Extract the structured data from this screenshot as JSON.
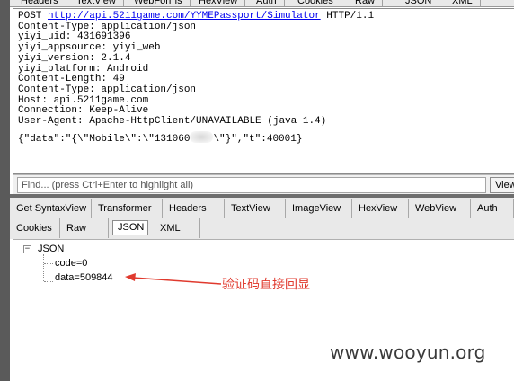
{
  "top_tabs": [
    "Headers",
    "TextView",
    "WebForms",
    "HexView",
    "Auth",
    "Cookies",
    "Raw",
    "JSON",
    "XML"
  ],
  "request": {
    "method": "POST",
    "url": "http://api.5211game.com/YYMEPassport/Simulator",
    "protocol": "HTTP/1.1",
    "lines": [
      "Content-Type: application/json",
      "yiyi_uid: 431691396",
      "yiyi_appsource: yiyi_web",
      "yiyi_version: 2.1.4",
      "yiyi_platform: Android",
      "Content-Length: 49",
      "Content-Type: application/json",
      "Host: api.5211game.com",
      "Connection: Keep-Alive",
      "User-Agent: Apache-HttpClient/UNAVAILABLE (java 1.4)"
    ],
    "body_prefix": "{\"data\":\"{\\\"Mobile\\\":\\\"131060",
    "body_suffix": "\\\"}\",\"t\":40001}"
  },
  "find_bar": {
    "placeholder": "Find... (press Ctrl+Enter to highlight all)",
    "view_button": "View"
  },
  "response_tabs": {
    "row1": [
      "Get SyntaxView",
      "Transformer",
      "Headers",
      "TextView",
      "ImageView",
      "HexView",
      "WebView",
      "Auth"
    ],
    "row2": [
      "Cookies",
      "Raw",
      "JSON",
      "XML"
    ],
    "active": "JSON"
  },
  "tree": {
    "expander": "−",
    "root": "JSON",
    "children": [
      "code=0",
      "data=509844"
    ]
  },
  "annotation": {
    "text": "验证码直接回显",
    "color": "#e03a2e"
  },
  "watermark": "www.wooyun.org",
  "colors": {
    "link": "#0000ee",
    "annotation": "#e03a2e",
    "tab_bg": "#e9e9e9"
  }
}
